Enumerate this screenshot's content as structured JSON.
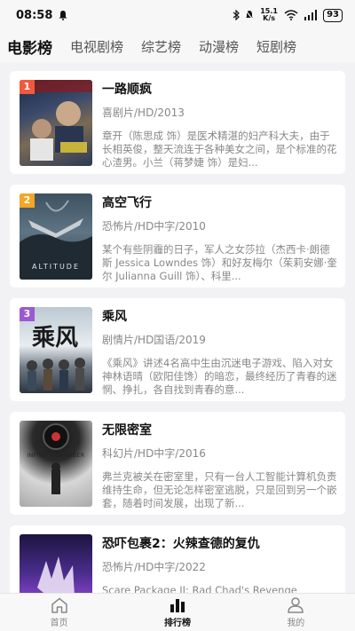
{
  "status": {
    "time": "08:58",
    "network_speed": "15.1 K/s",
    "battery": "93"
  },
  "tabs": [
    "电影榜",
    "电视剧榜",
    "综艺榜",
    "动漫榜",
    "短剧榜"
  ],
  "active_tab": "电影榜",
  "rank_colors": {
    "1": "#f05a3c",
    "2": "#f5a623",
    "3": "#9b59d0"
  },
  "movies": [
    {
      "rank": "1",
      "title": "一路顺疯",
      "meta": "喜剧片/HD/2013",
      "desc": "章开（陈思成 饰）是医术精湛的妇产科大夫，由于长相英俊，整天流连于各种美女之间，是个标准的花心渣男。小兰（蒋梦婕 饰）是妇..."
    },
    {
      "rank": "2",
      "title": "高空飞行",
      "meta": "恐怖片/HD中字/2010",
      "desc": "某个有些阴霾的日子，军人之女莎拉（杰西卡·朗德斯 Jessica Lowndes 饰）和好友梅尔（茱莉安娜·奎尔 Julianna Guill 饰）、科里..."
    },
    {
      "rank": "3",
      "title": "乘风",
      "meta": "剧情片/HD国语/2019",
      "desc": "《乘风》讲述4名高中生由沉迷电子游戏、陷入对女神林语晴（欧阳佳馋）的暗恋，最终经历了青春的迷惘、挣扎，各自找到青春的意..."
    },
    {
      "rank": "",
      "title": "无限密室",
      "meta": "科幻片/HD中字/2016",
      "desc": "弗兰克被关在密室里，只有一台人工智能计算机负责维持生命，但无论怎样密室逃脱，只是回到另一个嵌套，随着时间发展，出现了新..."
    },
    {
      "rank": "",
      "title": "恐吓包裹2：火辣查德的复仇",
      "meta": "恐怖片/HD中字/2022",
      "desc": "Scare Package II: Rad Chad's Revenge"
    }
  ],
  "poster_texts": {
    "altitude": "ALTITUDE",
    "chengfeng": "乘风",
    "infinity": "INFINITY CHAMBER"
  },
  "bottom_nav": [
    {
      "label": "首页",
      "icon": "home-icon"
    },
    {
      "label": "排行榜",
      "icon": "ranking-icon"
    },
    {
      "label": "我的",
      "icon": "user-icon"
    }
  ]
}
